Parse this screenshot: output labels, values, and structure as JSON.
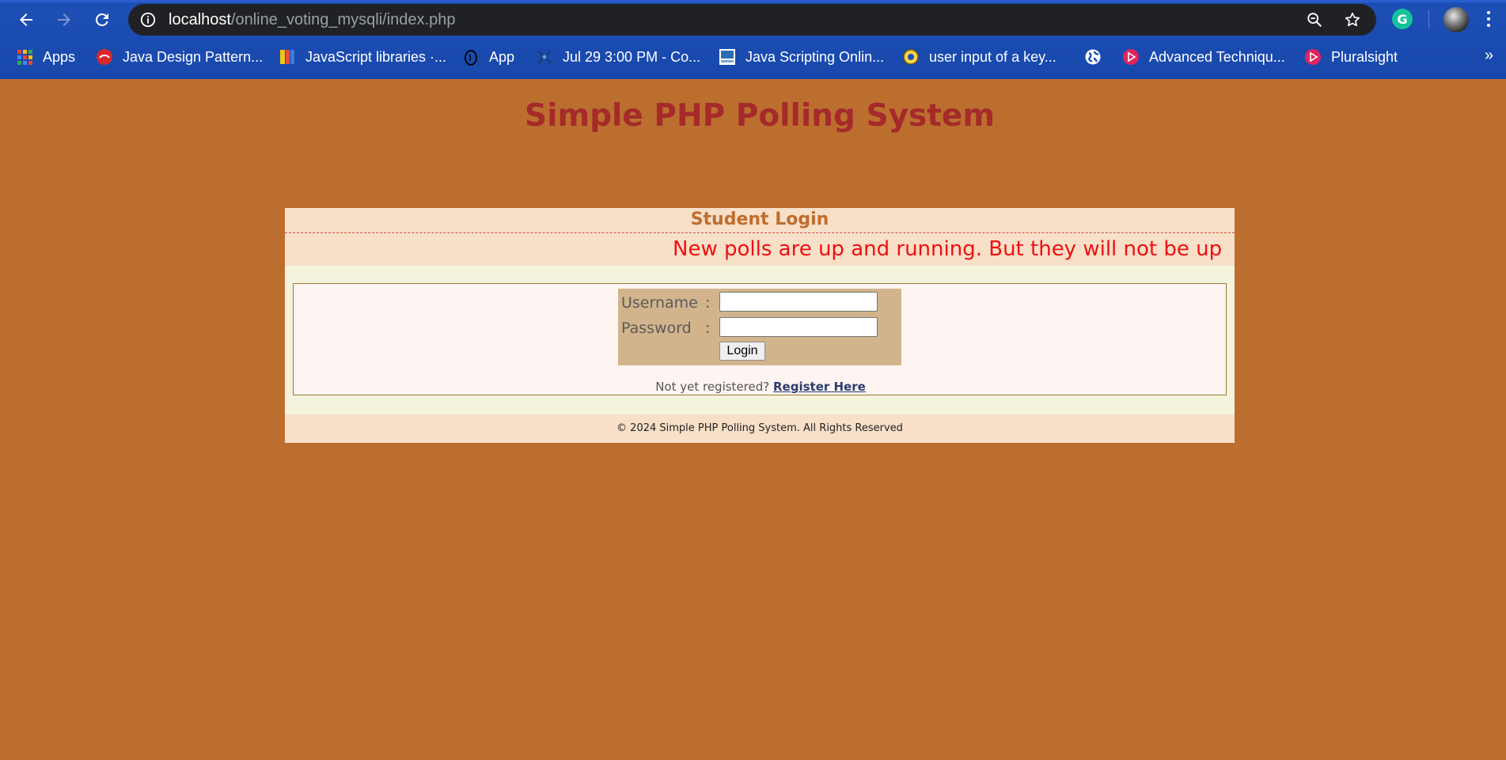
{
  "browser": {
    "url_host": "localhost",
    "url_path": "/online_voting_mysqli/index.php",
    "bookmarks": [
      {
        "label": "Apps",
        "icon": "apps-grid-icon"
      },
      {
        "label": "Java Design Pattern...",
        "icon": "java-design-pattern-favicon"
      },
      {
        "label": "JavaScript libraries ·...",
        "icon": "javascript-libraries-favicon"
      },
      {
        "label": "App",
        "icon": "app-favicon"
      },
      {
        "label": "Jul 29 3:00 PM - Co...",
        "icon": "calendar-event-favicon"
      },
      {
        "label": "Java Scripting Onlin...",
        "icon": "java-scripting-favicon"
      },
      {
        "label": "user input of a key...",
        "icon": "user-input-favicon"
      },
      {
        "label": "",
        "icon": "globe-icon"
      },
      {
        "label": "Advanced Techniqu...",
        "icon": "pluralsight-favicon"
      },
      {
        "label": "Pluralsight",
        "icon": "pluralsight-favicon"
      }
    ],
    "more_bookmarks": "»",
    "grammarly_letter": "G"
  },
  "page": {
    "site_title": "Simple PHP Polling System",
    "panel_title": "Student Login",
    "marquee_text": "New polls are up and running. But they will not be up",
    "username_label": "Username",
    "password_label": "Password",
    "colon": ":",
    "username_value": "",
    "password_value": "",
    "login_button": "Login",
    "not_registered": "Not yet registered?",
    "register_link": "Register Here",
    "footer": "© 2024 Simple PHP Polling System. All Rights Reserved"
  },
  "colors": {
    "page_background": "#bc6e2f",
    "title": "#a52a2a",
    "marquee": "#ee1010",
    "form_box": "#d2b48c"
  }
}
